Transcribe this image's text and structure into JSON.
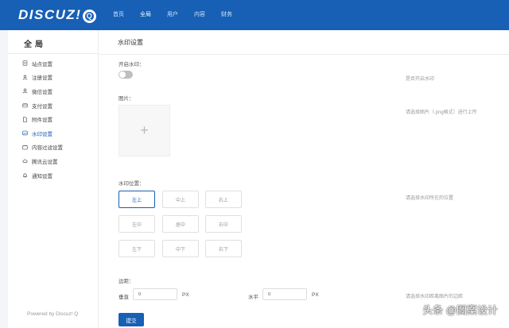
{
  "brand": {
    "logo_text": "DISCUZ!",
    "logo_q": "Q"
  },
  "topnav": [
    {
      "label": "首页",
      "active": false
    },
    {
      "label": "全局",
      "active": true
    },
    {
      "label": "用户",
      "active": false
    },
    {
      "label": "内容",
      "active": false
    },
    {
      "label": "财务",
      "active": false
    }
  ],
  "sidebar": {
    "title": "全局",
    "items": [
      {
        "label": "站点设置",
        "icon": "settings-doc-icon"
      },
      {
        "label": "注册设置",
        "icon": "user-icon"
      },
      {
        "label": "微信设置",
        "icon": "user-icon"
      },
      {
        "label": "支付设置",
        "icon": "wallet-icon"
      },
      {
        "label": "附件设置",
        "icon": "attachment-icon"
      },
      {
        "label": "水印设置",
        "icon": "image-icon",
        "active": true
      },
      {
        "label": "内容过滤设置",
        "icon": "filter-icon"
      },
      {
        "label": "腾讯云设置",
        "icon": "cloud-icon"
      },
      {
        "label": "通知设置",
        "icon": "bell-icon"
      }
    ],
    "powered": "Powered by Discuz! Q"
  },
  "main": {
    "title": "水印设置",
    "enable_label": "开启水印：",
    "enable_hint": "是否开启水印",
    "image_label": "图片：",
    "image_hint": "请选择图片（.png格式）进行上传",
    "upload_plus": "+",
    "position_label": "水印位置：",
    "position_hint": "请选择水印所在的位置",
    "positions": [
      "左上",
      "中上",
      "右上",
      "左中",
      "居中",
      "右中",
      "左下",
      "中下",
      "右下"
    ],
    "margin_label": "边距：",
    "margin_hint": "请选择水印距离图片的边距",
    "vertical_label": "垂直",
    "vertical_value": "0",
    "horizontal_label": "水平",
    "horizontal_value": "0",
    "unit": "PX",
    "submit_label": "提交"
  },
  "watermark_text": "头条 @图案设计",
  "colors": {
    "primary": "#1760b5"
  }
}
